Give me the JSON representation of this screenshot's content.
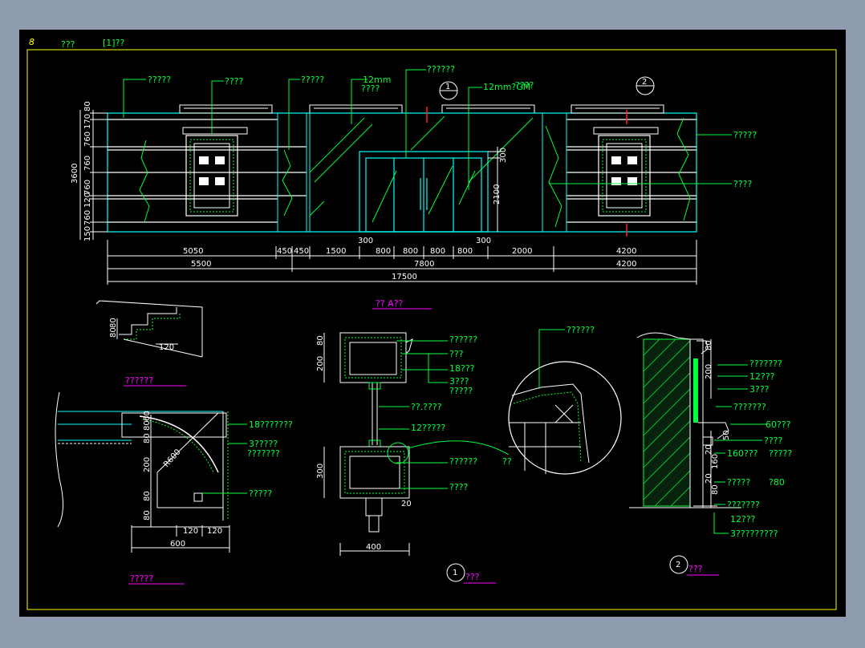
{
  "header": {
    "sheet_mark": "8",
    "title_a": "???",
    "title_b": "[1]??"
  },
  "elevation": {
    "callouts_top": [
      "?????",
      "????",
      "?????",
      "12mm",
      "????",
      "??????",
      "12mm?GM",
      "????"
    ],
    "callouts_right": [
      "?????",
      "????"
    ],
    "section_marks": [
      "1",
      "2"
    ],
    "left_dims": [
      "80",
      "170",
      "760",
      "760",
      "3600",
      "760",
      "120",
      "760",
      "150"
    ],
    "door_dims": [
      "300",
      "2100"
    ],
    "door_base_dims": [
      "300",
      "300"
    ],
    "dim_row1": [
      "5050",
      "450",
      "450",
      "1500",
      "800",
      "800",
      "800",
      "800",
      "2000",
      "4200"
    ],
    "dim_row2": [
      "5500",
      "7800",
      "4200"
    ],
    "dim_total": "17500"
  },
  "titles": {
    "elevation_view": "?? A??",
    "detail_step": "??????",
    "detail_corner": "?????",
    "section_1": "???",
    "section_2": "???"
  },
  "detail_step": {
    "dims": [
      "80",
      "80",
      "120"
    ]
  },
  "detail_corner": {
    "labels": [
      "18???????",
      "3?????",
      "???????",
      "?????"
    ],
    "dims": [
      "80",
      "60",
      "80",
      "200",
      "80",
      "80",
      "R600",
      "120",
      "120",
      "600"
    ]
  },
  "section_1": {
    "labels": [
      "??????",
      "???",
      "18???",
      "3???",
      "?????",
      "??.????",
      "12?????",
      "??????",
      "????",
      "??"
    ],
    "dims": [
      "200",
      "80",
      "300",
      "400",
      "20"
    ],
    "bubble": "??????"
  },
  "section_2": {
    "labels": [
      "???????",
      "12???",
      "3???",
      "???????",
      "60???",
      "????",
      "160???",
      "?????",
      "?????",
      "?80",
      "???????",
      "12???",
      "3?????????"
    ],
    "dims": [
      "200",
      "80",
      "50",
      "20",
      "160",
      "20",
      "80"
    ]
  },
  "colors": {
    "background": "#000000",
    "frame_bg": "#8e9bae",
    "line_green": "#00ff3c",
    "line_cyan": "#00ffff",
    "line_white": "#ffffff",
    "text_magenta": "#ff00ff",
    "line_red": "#ff2020",
    "border_yellow": "#ffff00"
  }
}
